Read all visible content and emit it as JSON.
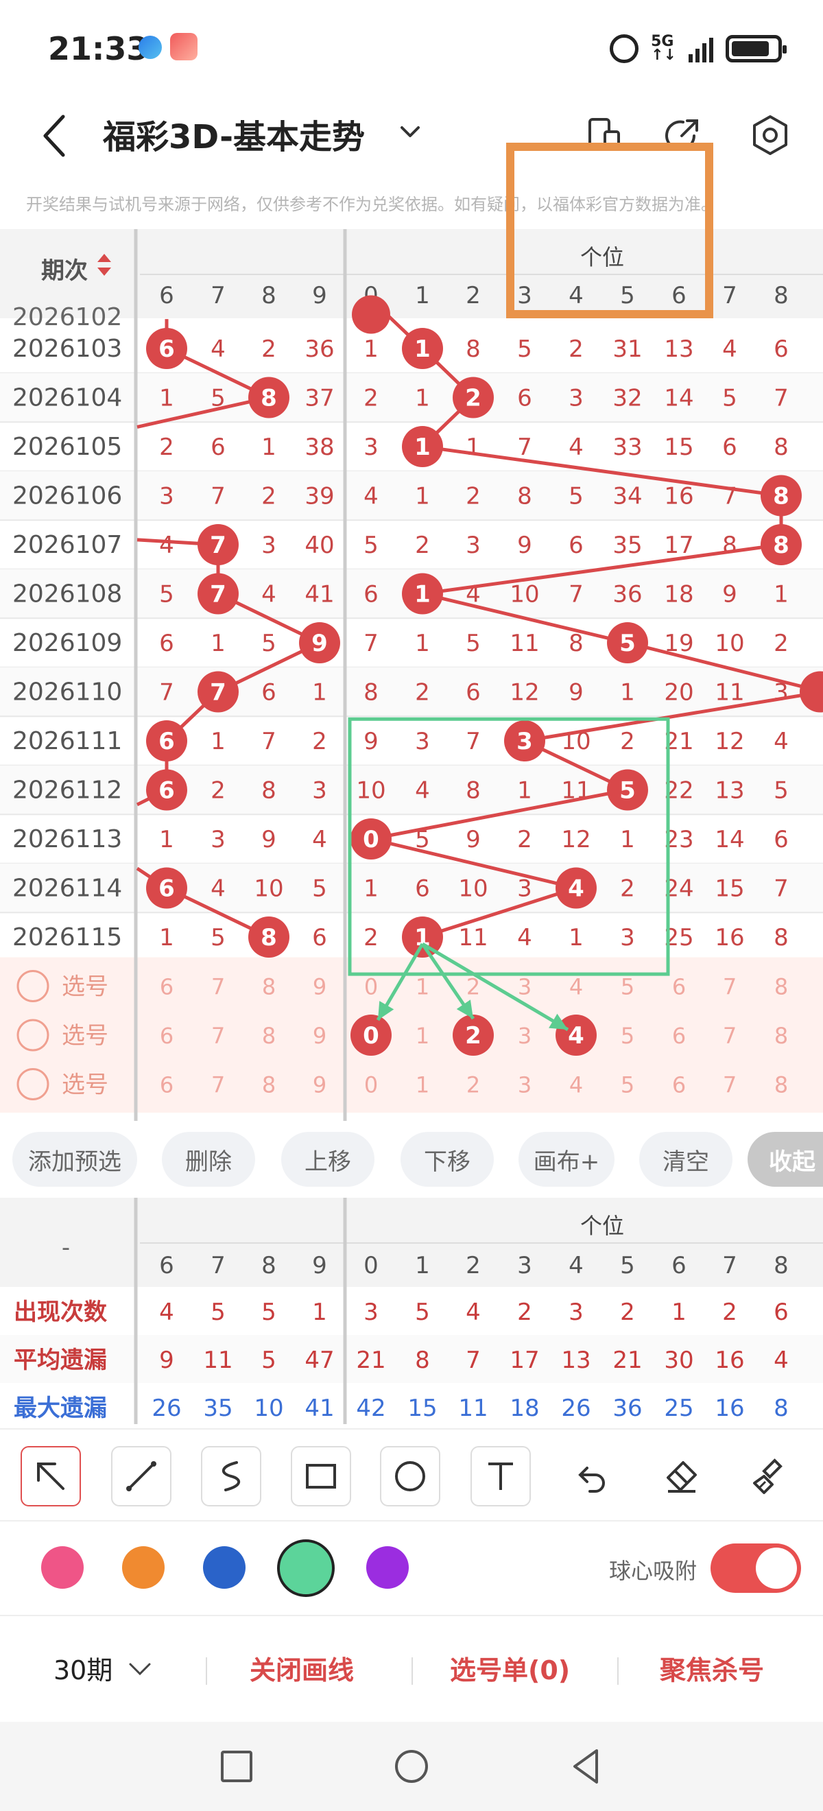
{
  "status": {
    "time": "21:33",
    "network": "5G"
  },
  "header": {
    "title": "福彩3D-基本走势",
    "notice": "开奖结果与试机号来源于网络，仅供参考不作为兑奖依据。如有疑问，以福体彩官方数据为准。"
  },
  "table": {
    "period_header": "期次",
    "group_label": "个位",
    "left_cols": [
      "6",
      "7",
      "8",
      "9"
    ],
    "right_cols": [
      "0",
      "1",
      "2",
      "3",
      "4",
      "5",
      "6",
      "7",
      "8"
    ],
    "partial_row": "2026102",
    "rows": [
      {
        "period": "2026103",
        "left": [
          "6",
          "4",
          "2",
          "36"
        ],
        "right": [
          "1",
          "1",
          "8",
          "5",
          "2",
          "31",
          "13",
          "4",
          "6"
        ]
      },
      {
        "period": "2026104",
        "left": [
          "1",
          "5",
          "8",
          "37"
        ],
        "right": [
          "2",
          "1",
          "2",
          "6",
          "3",
          "32",
          "14",
          "5",
          "7"
        ]
      },
      {
        "period": "2026105",
        "left": [
          "2",
          "6",
          "1",
          "38"
        ],
        "right": [
          "3",
          "1",
          "1",
          "7",
          "4",
          "33",
          "15",
          "6",
          "8"
        ]
      },
      {
        "period": "2026106",
        "left": [
          "3",
          "7",
          "2",
          "39"
        ],
        "right": [
          "4",
          "1",
          "2",
          "8",
          "5",
          "34",
          "16",
          "7",
          "8"
        ]
      },
      {
        "period": "2026107",
        "left": [
          "4",
          "7",
          "3",
          "40"
        ],
        "right": [
          "5",
          "2",
          "3",
          "9",
          "6",
          "35",
          "17",
          "8",
          "8"
        ]
      },
      {
        "period": "2026108",
        "left": [
          "5",
          "7",
          "4",
          "41"
        ],
        "right": [
          "6",
          "1",
          "4",
          "10",
          "7",
          "36",
          "18",
          "9",
          "1"
        ]
      },
      {
        "period": "2026109",
        "left": [
          "6",
          "1",
          "5",
          "9"
        ],
        "right": [
          "7",
          "1",
          "5",
          "11",
          "8",
          "5",
          "19",
          "10",
          "2"
        ]
      },
      {
        "period": "2026110",
        "left": [
          "7",
          "7",
          "6",
          "1"
        ],
        "right": [
          "8",
          "2",
          "6",
          "12",
          "9",
          "1",
          "20",
          "11",
          "3"
        ]
      },
      {
        "period": "2026111",
        "left": [
          "6",
          "1",
          "7",
          "2"
        ],
        "right": [
          "9",
          "3",
          "7",
          "3",
          "10",
          "2",
          "21",
          "12",
          "4"
        ]
      },
      {
        "period": "2026112",
        "left": [
          "6",
          "2",
          "8",
          "3"
        ],
        "right": [
          "10",
          "4",
          "8",
          "1",
          "11",
          "5",
          "22",
          "13",
          "5"
        ]
      },
      {
        "period": "2026113",
        "left": [
          "1",
          "3",
          "9",
          "4"
        ],
        "right": [
          "0",
          "5",
          "9",
          "2",
          "12",
          "1",
          "23",
          "14",
          "6"
        ]
      },
      {
        "period": "2026114",
        "left": [
          "6",
          "4",
          "10",
          "5"
        ],
        "right": [
          "1",
          "6",
          "10",
          "3",
          "4",
          "2",
          "24",
          "15",
          "7"
        ]
      },
      {
        "period": "2026115",
        "left": [
          "1",
          "5",
          "8",
          "6"
        ],
        "right": [
          "2",
          "1",
          "11",
          "4",
          "1",
          "3",
          "25",
          "16",
          "8"
        ]
      }
    ],
    "select_label": "选号",
    "select_rows": 3
  },
  "actions": {
    "add": "添加预选",
    "delete": "删除",
    "up": "上移",
    "down": "下移",
    "canvas": "画布+",
    "clear": "清空",
    "collapse": "收起"
  },
  "stats": {
    "dash": "-",
    "group_label": "个位",
    "rows": [
      {
        "label": "出现次数",
        "color": "#c83c3c",
        "values": [
          "4",
          "5",
          "5",
          "1",
          "3",
          "5",
          "4",
          "2",
          "3",
          "2",
          "1",
          "2",
          "6"
        ]
      },
      {
        "label": "平均遗漏",
        "color": "#c83c3c",
        "values": [
          "9",
          "11",
          "5",
          "47",
          "21",
          "8",
          "7",
          "17",
          "13",
          "21",
          "30",
          "16",
          "4"
        ]
      },
      {
        "label": "最大遗漏",
        "color": "#3b6fd6",
        "values": [
          "26",
          "35",
          "10",
          "41",
          "42",
          "15",
          "11",
          "18",
          "26",
          "36",
          "25",
          "16",
          "8"
        ]
      }
    ]
  },
  "draw": {
    "snap_label": "球心吸附",
    "colors": [
      "#ef5587",
      "#f08a30",
      "#2a63c9",
      "#5cd49a",
      "#9b2de0"
    ]
  },
  "bottom": {
    "period": "30期",
    "close_lines": "关闭画线",
    "ticket": "选号单(0)",
    "focus_kill": "聚焦杀号"
  }
}
